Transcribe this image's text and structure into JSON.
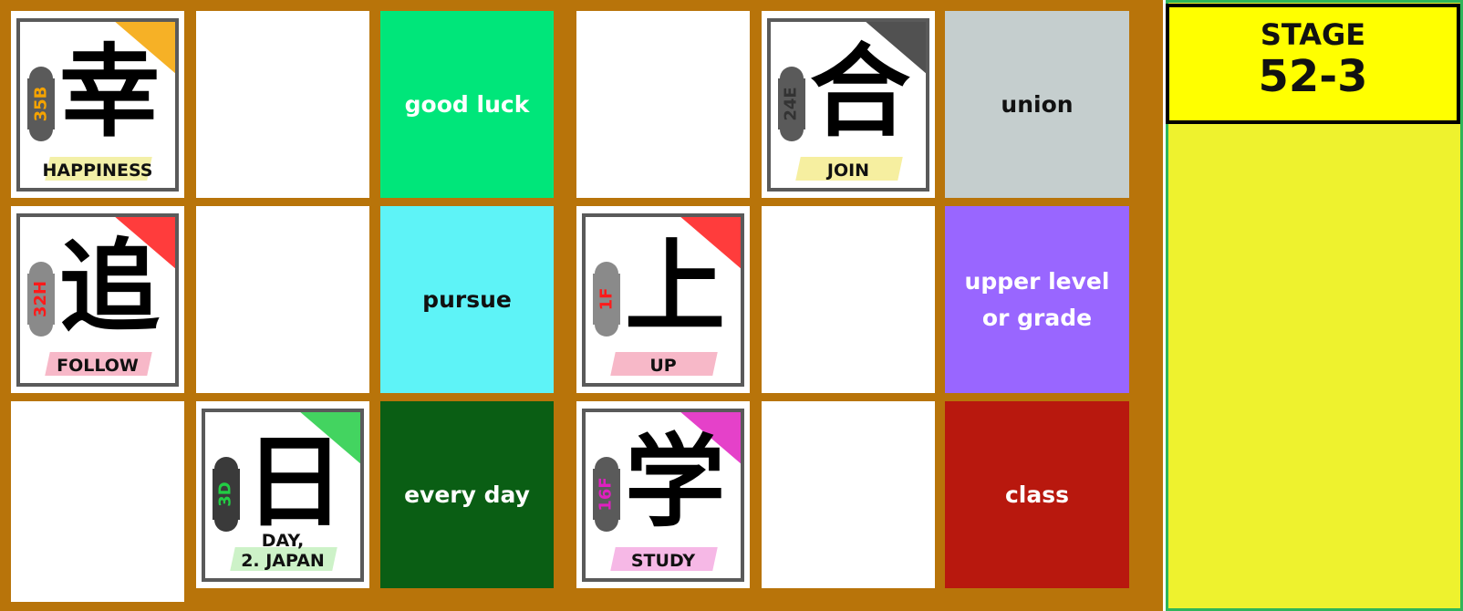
{
  "stage": {
    "label": "STAGE",
    "number": "52-3"
  },
  "cards": [
    {
      "kanji": "幸",
      "code": "35B",
      "meaning": "HAPPINESS",
      "accent": "#f5a300",
      "highlight": "#f3f0a8"
    },
    {
      "kanji": "合",
      "code": "24E",
      "meaning": "JOIN",
      "accent": "#333333",
      "highlight": "#f6efa0"
    },
    {
      "kanji": "追",
      "code": "32H",
      "meaning": "FOLLOW",
      "accent": "#ff1a1a",
      "highlight": "#f7b8c8"
    },
    {
      "kanji": "上",
      "code": "1F",
      "meaning": "UP",
      "accent": "#ff1a1a",
      "highlight": "#f7b8c8"
    },
    {
      "kanji": "日",
      "code": "3D",
      "meaning": "DAY,\n2. JAPAN",
      "accent": "#22cc44",
      "highlight": "#cdf2c8"
    },
    {
      "kanji": "学",
      "code": "16F",
      "meaning": "STUDY",
      "accent": "#e020c0",
      "highlight": "#f6b8e6"
    }
  ],
  "words": [
    {
      "text": "good luck",
      "bg": "#00e67a"
    },
    {
      "text": "union",
      "bg": "#c5cece"
    },
    {
      "text": "pursue",
      "bg": "#5ef3f7"
    },
    {
      "text": "upper level or grade",
      "bg": "#9966ff"
    },
    {
      "text": "every day",
      "bg": "#0a5e14"
    },
    {
      "text": "class",
      "bg": "#b8180e"
    }
  ],
  "colors": {
    "board": "#b8740a",
    "panel": "#eef22e",
    "stage_box": "#ffff00"
  }
}
